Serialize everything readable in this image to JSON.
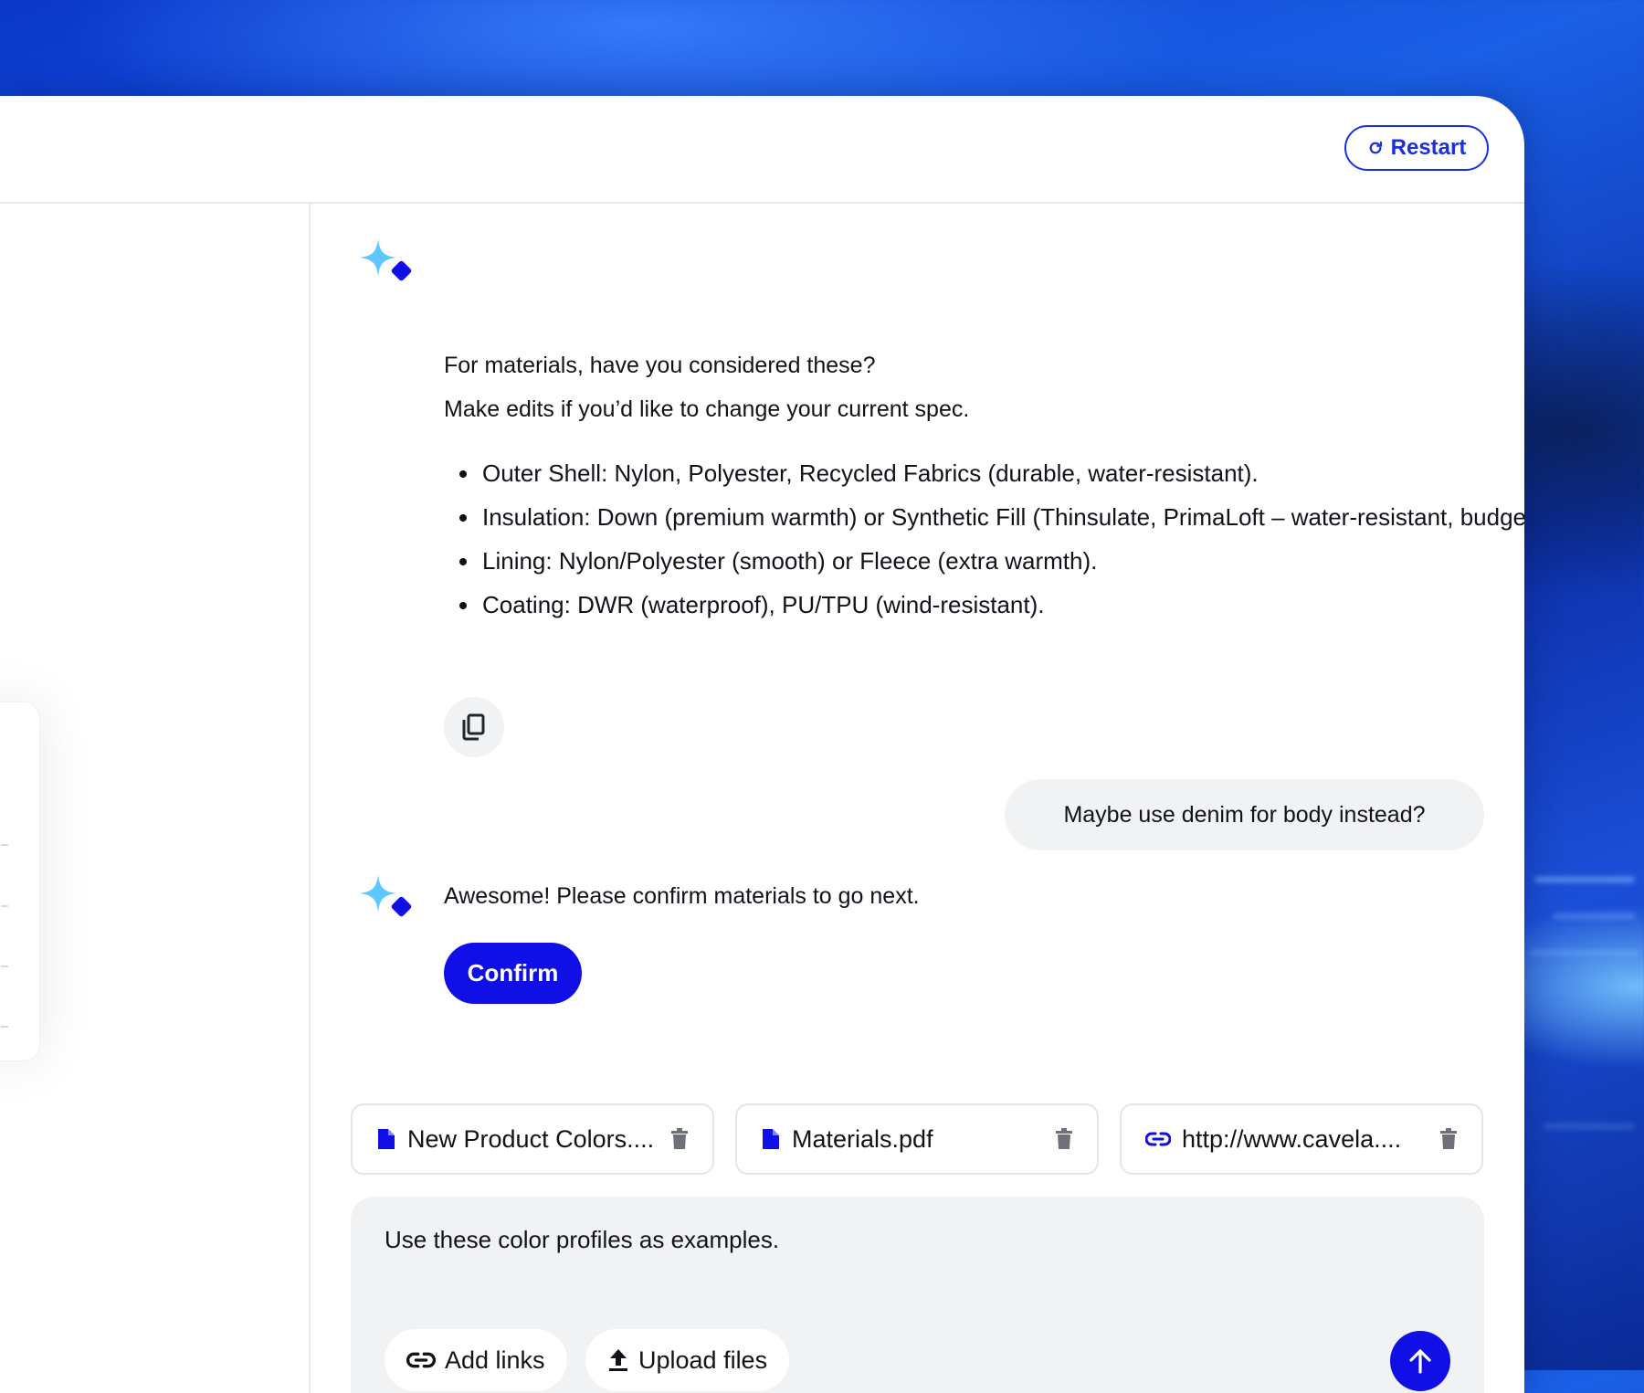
{
  "header": {
    "restart_label": "Restart",
    "restart_icon": "refresh-icon"
  },
  "messages": {
    "bot1": {
      "line1": "For materials, have you considered these?",
      "line2": "Make edits if you’d like to change your current spec.",
      "bullets": [
        "Outer Shell: Nylon, Polyester, Recycled Fabrics (durable, water-resistant).",
        "Insulation: Down (premium warmth) or Synthetic Fill (Thinsulate, PrimaLoft – water-resistant, budget-friendly).",
        "Lining: Nylon/Polyester (smooth) or Fleece (extra warmth).",
        "Coating: DWR (waterproof), PU/TPU (wind-resistant)."
      ],
      "copy_icon": "copy-icon"
    },
    "user1": "Maybe use denim for body instead?",
    "bot2": {
      "text": "Awesome! Please confirm materials to go next.",
      "confirm_label": "Confirm"
    }
  },
  "attachments": [
    {
      "name": "New Product Colors....",
      "icon": "file-icon"
    },
    {
      "name": "Materials.pdf",
      "icon": "file-icon"
    },
    {
      "name": "http://www.cavela....",
      "icon": "link-icon"
    }
  ],
  "composer": {
    "text": "Use these color profiles as examples.",
    "add_links_label": "Add links",
    "upload_files_label": "Upload files",
    "send_icon": "arrow-up-icon"
  },
  "colors": {
    "accent": "#1010E6",
    "sparkle_light": "#5CC8FF",
    "bubble_bg": "#F1F2F4"
  }
}
